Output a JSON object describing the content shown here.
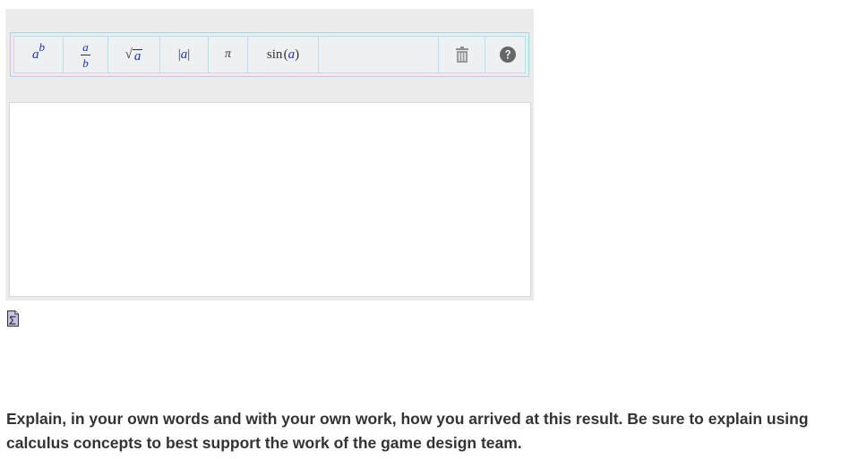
{
  "toolbar": {
    "buttons": [
      {
        "id": "power",
        "base": "a",
        "exponent": "b"
      },
      {
        "id": "fraction",
        "numerator": "a",
        "denominator": "b"
      },
      {
        "id": "sqrt",
        "radicand": "a"
      },
      {
        "id": "abs",
        "label_left": "|",
        "label_var": "a",
        "label_right": "|"
      },
      {
        "id": "pi",
        "label": "π"
      },
      {
        "id": "sin",
        "fn": "sin",
        "open": "(",
        "var": "a",
        "close": ")"
      }
    ],
    "trash_icon": "trash-icon",
    "help_icon": "help-icon"
  },
  "answer_box": {
    "value": ""
  },
  "equation_icon": "sigma-icon",
  "question": {
    "text": "Explain, in your own words and with your own work, how you arrived at this result. Be sure to explain using calculus concepts to best support the work of the game design team."
  }
}
